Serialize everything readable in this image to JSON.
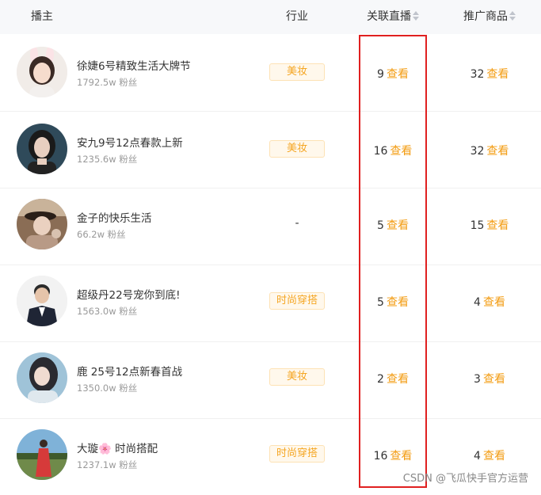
{
  "header": {
    "streamer": "播主",
    "industry": "行业",
    "live": "关联直播",
    "goods": "推广商品"
  },
  "rows": [
    {
      "name": "徐婕6号精致生活大牌节",
      "fans": "1792.5w 粉丝",
      "industry": "美妆",
      "live_count": "9",
      "goods_count": "32",
      "view": "查看"
    },
    {
      "name": "安九9号12点春款上新",
      "fans": "1235.6w 粉丝",
      "industry": "美妆",
      "live_count": "16",
      "goods_count": "32",
      "view": "查看"
    },
    {
      "name": "金子的快乐生活",
      "fans": "66.2w 粉丝",
      "industry": "-",
      "live_count": "5",
      "goods_count": "15",
      "view": "查看"
    },
    {
      "name": "超级丹22号宠你到底!",
      "fans": "1563.0w 粉丝",
      "industry": "时尚穿搭",
      "live_count": "5",
      "goods_count": "4",
      "view": "查看"
    },
    {
      "name": "鹿 25号12点新春首战",
      "fans": "1350.0w 粉丝",
      "industry": "美妆",
      "live_count": "2",
      "goods_count": "3",
      "view": "查看"
    },
    {
      "name": "大璇🌸 时尚搭配",
      "fans": "1237.1w 粉丝",
      "industry": "时尚穿搭",
      "live_count": "16",
      "goods_count": "4",
      "view": "查看"
    }
  ],
  "colors": {
    "accent": "#f39c12",
    "highlight_border": "#e02020"
  },
  "watermark": "CSDN @飞瓜快手官方运营"
}
